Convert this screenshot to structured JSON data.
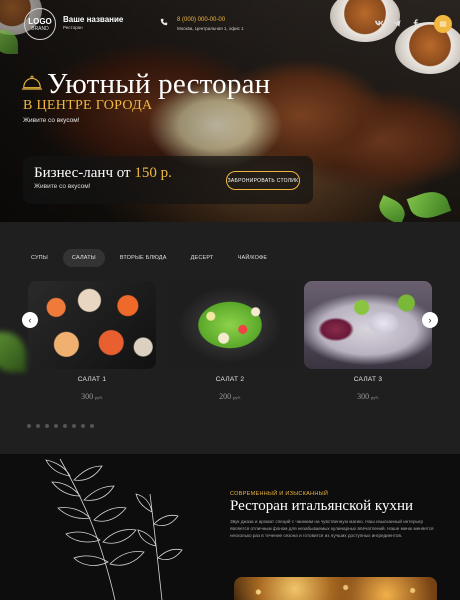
{
  "header": {
    "logo_line1": "LOGO",
    "logo_line2": "BRAND",
    "brand_name": "Ваше название",
    "brand_sub": "Ресторан",
    "phone": "8 (000) 000-00-00",
    "address": "Москва, Центральная 1, офис 1",
    "social_icons": [
      "vk-icon",
      "telegram-icon",
      "facebook-icon"
    ],
    "menu_icon": "menu-icon"
  },
  "hero": {
    "title": "Уютный ресторан",
    "subtitle": "В ЦЕНТРЕ ГОРОДА",
    "tagline": "Живите со вкусом!",
    "lunch_title": "Бизнес-ланч от",
    "lunch_price": "150 р.",
    "lunch_sub": "Живите со вкусом!",
    "book_button": "ЗАБРОНИРОВАТЬ СТОЛИК"
  },
  "menu": {
    "tabs": [
      {
        "label": "СУПЫ",
        "active": false
      },
      {
        "label": "САЛАТЫ",
        "active": true
      },
      {
        "label": "ВТОРЫЕ БЛЮДА",
        "active": false
      },
      {
        "label": "ДЕСЕРТ",
        "active": false
      },
      {
        "label": "ЧАЙ/КОФЕ",
        "active": false
      }
    ],
    "cards": [
      {
        "name": "САЛАТ 1",
        "price": "300",
        "currency": "руб."
      },
      {
        "name": "САЛАТ 2",
        "price": "200",
        "currency": "руб."
      },
      {
        "name": "САЛАТ 3",
        "price": "300",
        "currency": "руб."
      }
    ],
    "prev_icon": "chevron-left-icon",
    "next_icon": "chevron-right-icon",
    "pagination_dots": 8
  },
  "about": {
    "kicker": "СОВРЕМЕННЫЙ И ИЗЫСКАННЫЙ",
    "title": "Ресторан итальянской кухни",
    "text": "Звук джаза и аромат специй с чаинким на чувственную магию. Наш изысканный интерьер является отличным фоном для незабываемых кулинарных впечатлений. Наше меню меняется несколько раз в течение сезона и готовится из лучших доступных ингредиентов."
  },
  "colors": {
    "accent": "#f0b840",
    "dark_bg": "#1f1f1f",
    "darker_bg": "#0d0d0d"
  }
}
